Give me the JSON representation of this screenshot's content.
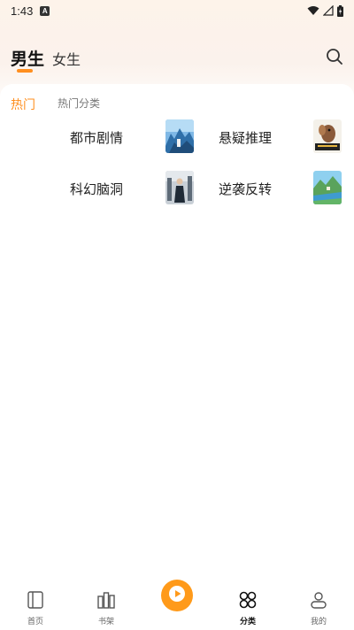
{
  "status_bar": {
    "time": "1:43",
    "notification_icon": "A",
    "icons": [
      "wifi-icon",
      "signal-icon",
      "battery-icon"
    ]
  },
  "header": {
    "tabs": [
      {
        "label": "男生",
        "active": true
      },
      {
        "label": "女生",
        "active": false
      }
    ],
    "search_icon": "search-icon"
  },
  "category_tabs": [
    {
      "label": "热门",
      "active": true
    },
    {
      "label": "热门分类",
      "active": false
    }
  ],
  "categories": [
    {
      "label": "都市剧情",
      "thumb": "city-cover"
    },
    {
      "label": "悬疑推理",
      "thumb": "squirrel-cover"
    },
    {
      "label": "科幻脑洞",
      "thumb": "scifi-cover"
    },
    {
      "label": "逆袭反转",
      "thumb": "landscape-cover"
    }
  ],
  "bottom_nav": [
    {
      "label": "首页",
      "icon": "home-icon",
      "active": false
    },
    {
      "label": "书架",
      "icon": "bookshelf-icon",
      "active": false
    },
    {
      "label": "",
      "icon": "play-icon",
      "active": false
    },
    {
      "label": "分类",
      "icon": "category-icon",
      "active": true
    },
    {
      "label": "我的",
      "icon": "profile-icon",
      "active": false
    }
  ],
  "colors": {
    "accent": "#ff8f1f",
    "play_button": "#ff9a1a",
    "header_gradient": "#fdf3ea"
  }
}
